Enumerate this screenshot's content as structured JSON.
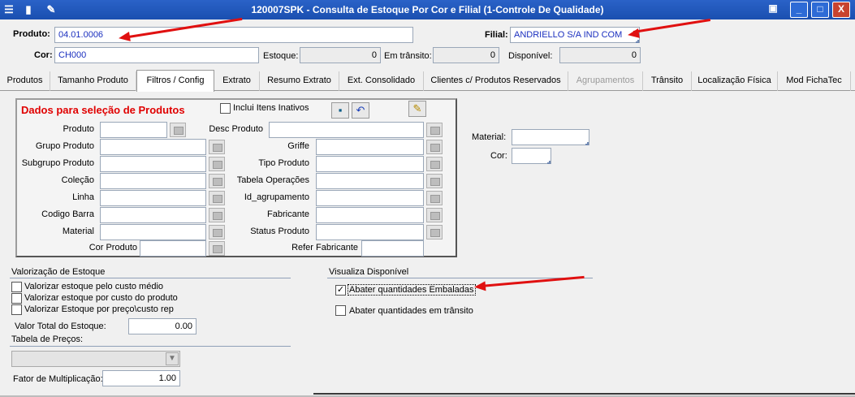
{
  "window": {
    "title": "120007SPK - Consulta de Estoque Por Cor e Filial (1-Controle De Qualidade)",
    "min_label": "_",
    "max_label": "□",
    "close_label": "X"
  },
  "header": {
    "produto_label": "Produto:",
    "produto_value": "04.01.0006",
    "filial_label": "Filial:",
    "filial_value": "ANDRIELLO S/A IND COM",
    "cor_label": "Cor:",
    "cor_value": "CH000",
    "estoque_label": "Estoque:",
    "estoque_value": "0",
    "transito_label": "Em trânsito:",
    "transito_value": "0",
    "disponivel_label": "Disponível:",
    "disponivel_value": "0"
  },
  "tabs": [
    {
      "label": "Produtos"
    },
    {
      "label": "Tamanho Produto"
    },
    {
      "label": "Filtros / Config"
    },
    {
      "label": "Extrato"
    },
    {
      "label": "Resumo Extrato"
    },
    {
      "label": "Ext. Consolidado"
    },
    {
      "label": "Clientes c/ Produtos Reservados"
    },
    {
      "label": "Agrupamentos"
    },
    {
      "label": "Trânsito"
    },
    {
      "label": "Localização Física"
    },
    {
      "label": "Mod FichaTec"
    }
  ],
  "active_tab": "Filtros / Config",
  "filters": {
    "title": "Dados para seleção de Produtos",
    "incluir_inativos": "Inclui Itens Inativos",
    "left": [
      {
        "label": "Produto",
        "value": ""
      },
      {
        "label": "Grupo Produto",
        "value": ""
      },
      {
        "label": "Subgrupo Produto",
        "value": ""
      },
      {
        "label": "Coleção",
        "value": ""
      },
      {
        "label": "Linha",
        "value": ""
      },
      {
        "label": "Codigo Barra",
        "value": ""
      },
      {
        "label": "Material",
        "value": ""
      },
      {
        "label": "Cor Produto",
        "value": ""
      }
    ],
    "right": [
      {
        "label": "Desc Produto",
        "value": ""
      },
      {
        "label": "Griffe",
        "value": ""
      },
      {
        "label": "Tipo Produto",
        "value": ""
      },
      {
        "label": "Tabela Operações",
        "value": ""
      },
      {
        "label": "Id_agrupamento",
        "value": ""
      },
      {
        "label": "Fabricante",
        "value": ""
      },
      {
        "label": "Status Produto",
        "value": ""
      },
      {
        "label": "Refer Fabricante",
        "value": ""
      }
    ]
  },
  "side": {
    "material_label": "Material:",
    "cor_label": "Cor:"
  },
  "valorizacao": {
    "title": "Valorização de Estoque",
    "options": [
      "Valorizar estoque pelo custo médio",
      "Valorizar estoque por custo do produto",
      "Valorizar Estoque por preço\\custo rep"
    ],
    "valor_total_label": "Valor Total do Estoque:",
    "valor_total_value": "0.00",
    "tabela_precos_label": "Tabela de Preços:",
    "fator_label": "Fator de Multiplicação:",
    "fator_value": "1.00"
  },
  "visualiza": {
    "title": "Visualiza Disponível",
    "abater_embaladas": "Abater quantidades Embaladas",
    "abater_embaladas_checked": true,
    "abater_transito": "Abater quantidades em trânsito",
    "abater_transito_checked": false
  },
  "colors": {
    "titlebar": "#1a4fb0",
    "annotation_arrow": "#e01010",
    "panel_title": "#e00000"
  }
}
